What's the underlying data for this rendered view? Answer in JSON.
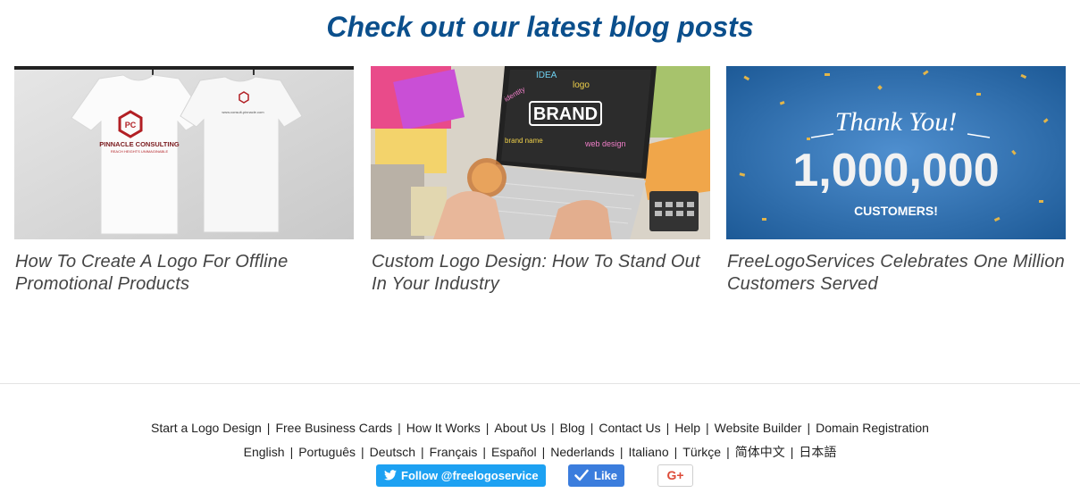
{
  "heading": "Check out our latest blog posts",
  "posts": [
    {
      "title": "How To Create A Logo For Offline Promotional Products",
      "shirt_brand": "PINNACLE CONSULTING",
      "shirt_tagline": "REACH HEIGHTS UNIMAGINABLE",
      "shirt_monogram": "PC",
      "shirt_url": "www.consult-pinnacle.com"
    },
    {
      "title": "Custom Logo Design: How To Stand Out In Your Industry",
      "screen_words": {
        "center": "BRAND",
        "idea": "IDEA",
        "logo": "logo",
        "ident": "identity",
        "name": "brand name",
        "web": "web design"
      }
    },
    {
      "title": "FreeLogoServices Celebrates One Million Customers Served",
      "thanks": "Thank You!",
      "number": "1,000,000",
      "customers": "CUSTOMERS!"
    }
  ],
  "footer": {
    "links": [
      "Start a Logo Design",
      "Free Business Cards",
      "How It Works",
      "About Us",
      "Blog",
      "Contact Us",
      "Help",
      "Website Builder",
      "Domain Registration"
    ],
    "languages": [
      "English",
      "Português",
      "Deutsch",
      "Français",
      "Español",
      "Nederlands",
      "Italiano",
      "Türkçe",
      "简体中文",
      "日本語"
    ],
    "twitter_label": "Follow @freelogoservice",
    "facebook_label": "Like",
    "google_label": "G+"
  },
  "colors": {
    "heading": "#0b4f8c",
    "twitter": "#1da1f2",
    "facebook": "#3b7ddd",
    "google": "#dd4b39"
  },
  "icons": [
    "twitter-bird-icon",
    "facebook-like-check-icon",
    "google-plus-icon"
  ]
}
